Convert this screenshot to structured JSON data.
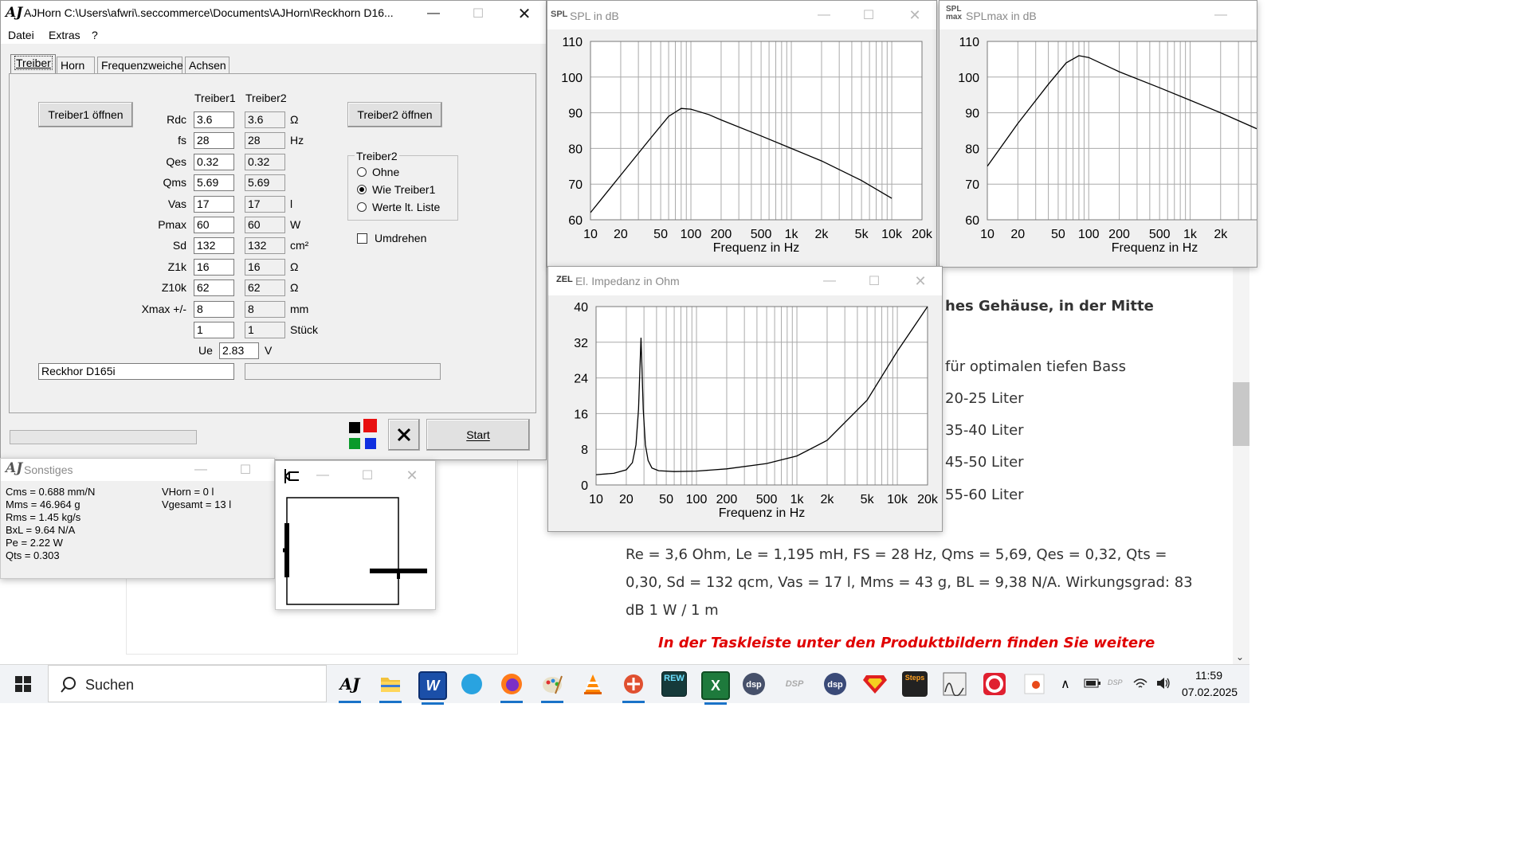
{
  "main_window": {
    "title": "AJHorn  C:\\Users\\afwri\\.seccommerce\\Documents\\AJHorn\\Reckhorn D16...",
    "menu": [
      "Datei",
      "Extras",
      "?"
    ],
    "tabs": [
      "Treiber",
      "Horn",
      "Frequenzweiche",
      "Achsen"
    ],
    "col_header_1": "Treiber1",
    "col_header_2": "Treiber2",
    "open_driver1_button": "Treiber1 öffnen",
    "open_driver2_button": "Treiber2 öffnen",
    "params": [
      {
        "label": "Rdc",
        "v1": "3.6",
        "v2": "3.6",
        "unit": "Ω"
      },
      {
        "label": "fs",
        "v1": "28",
        "v2": "28",
        "unit": "Hz"
      },
      {
        "label": "Qes",
        "v1": "0.32",
        "v2": "0.32",
        "unit": ""
      },
      {
        "label": "Qms",
        "v1": "5.69",
        "v2": "5.69",
        "unit": ""
      },
      {
        "label": "Vas",
        "v1": "17",
        "v2": "17",
        "unit": "l"
      },
      {
        "label": "Pmax",
        "v1": "60",
        "v2": "60",
        "unit": "W"
      },
      {
        "label": "Sd",
        "v1": "132",
        "v2": "132",
        "unit": "cm²"
      },
      {
        "label": "Z1k",
        "v1": "16",
        "v2": "16",
        "unit": "Ω"
      },
      {
        "label": "Z10k",
        "v1": "62",
        "v2": "62",
        "unit": "Ω"
      },
      {
        "label": "Xmax +/-",
        "v1": "8",
        "v2": "8",
        "unit": "mm"
      },
      {
        "label": "",
        "v1": "1",
        "v2": "1",
        "unit": "Stück"
      }
    ],
    "ue_label": "Ue",
    "ue_value": "2.83",
    "ue_unit": "V",
    "driver2_group_label": "Treiber2",
    "driver2_options": [
      "Ohne",
      "Wie Treiber1",
      "Werte lt. Liste"
    ],
    "driver2_selected": "Wie Treiber1",
    "invert_label": "Umdrehen",
    "driver1_name": "Reckhor D165i",
    "driver2_name": "",
    "start_button": "Start",
    "colors": {
      "black": "#000000",
      "red": "#e81010",
      "green": "#0a9a2a",
      "blue": "#1030e0"
    }
  },
  "sonstiges_window": {
    "title": "Sonstiges",
    "left": [
      "Cms = 0.688 mm/N",
      "Mms = 46.964 g",
      "Rms = 1.45 kg/s",
      "BxL = 9.64 N/A",
      "Pe = 2.22 W",
      "Qts = 0.303"
    ],
    "right": [
      "VHorn = 0 l",
      "Vgesamt = 13 l"
    ]
  },
  "spl_window": {
    "icon_text": "SPL",
    "title": "SPL in dB",
    "chart_data": {
      "type": "line",
      "title": "SPL in dB",
      "xlabel": "Frequenz in Hz",
      "ylabel": "",
      "xscale": "log",
      "xlim": [
        10,
        20000
      ],
      "ylim": [
        60,
        110
      ],
      "xticks": [
        "10",
        "20",
        "50",
        "100",
        "200",
        "500",
        "1k",
        "2k",
        "5k",
        "10k",
        "20k"
      ],
      "yticks": [
        "60",
        "70",
        "80",
        "90",
        "100",
        "110"
      ],
      "x": [
        10,
        20,
        40,
        60,
        80,
        100,
        150,
        200,
        500,
        1000,
        2000,
        5000,
        10000
      ],
      "y": [
        62,
        72.5,
        83,
        89,
        91.2,
        91,
        89.5,
        88,
        83.5,
        80,
        76.5,
        71,
        66
      ]
    }
  },
  "splmax_window": {
    "icon_text": "SPL max",
    "title": "SPLmax in dB",
    "chart_data": {
      "type": "line",
      "title": "SPLmax in dB",
      "xlabel": "Frequenz in Hz",
      "xscale": "log",
      "xlim": [
        10,
        5000
      ],
      "ylim": [
        60,
        110
      ],
      "xticks": [
        "10",
        "20",
        "50",
        "100",
        "200",
        "500",
        "1k",
        "2k"
      ],
      "yticks": [
        "60",
        "70",
        "80",
        "90",
        "100",
        "110"
      ],
      "x": [
        10,
        20,
        40,
        60,
        80,
        100,
        200,
        500,
        1000,
        2000,
        5000
      ],
      "y": [
        75,
        87,
        98,
        104,
        106,
        105.5,
        101.5,
        97,
        93.5,
        90,
        85
      ]
    }
  },
  "impedance_window": {
    "icon_text": "ZEL",
    "title": "El. Impedanz in Ohm",
    "chart_data": {
      "type": "line",
      "title": "El. Impedanz in Ohm",
      "xlabel": "Frequenz in Hz",
      "xscale": "log",
      "xlim": [
        10,
        20000
      ],
      "ylim": [
        0,
        40
      ],
      "xticks": [
        "10",
        "20",
        "50",
        "100",
        "200",
        "500",
        "1k",
        "2k",
        "5k",
        "10k",
        "20k"
      ],
      "yticks": [
        "0",
        "8",
        "16",
        "24",
        "32",
        "40"
      ],
      "x": [
        10,
        15,
        20,
        23,
        25,
        26.5,
        27.5,
        28,
        28.5,
        29.5,
        31,
        33,
        36,
        42,
        60,
        100,
        200,
        500,
        1000,
        2000,
        5000,
        10000,
        20000
      ],
      "y": [
        2.3,
        2.6,
        3.4,
        5.0,
        9.0,
        17,
        28,
        33,
        28,
        17,
        9,
        5.5,
        3.8,
        3.2,
        3.0,
        3.1,
        3.6,
        4.8,
        6.5,
        10,
        19,
        30,
        40
      ]
    }
  },
  "doc_text": {
    "line_gehaeuse": "hes Gehäuse, in der Mitte",
    "line_bass": "für optimalen tiefen Bass",
    "line_20": "20-25 Liter",
    "line_35": "35-40 Liter",
    "line_45": "45-50 Liter",
    "line_55": "55-60 Liter",
    "params_line1": "Re = 3,6 Ohm, Le = 1,195 mH, FS = 28 Hz, Qms = 5,69, Qes = 0,32, Qts =",
    "params_line2": "0,30, Sd = 132 qcm, Vas = 17 l, Mms = 43 g, BL = 9,38 N/A. Wirkungsgrad: 83",
    "params_line3": "dB 1 W / 1 m",
    "red_note": "In der Taskleiste unter den Produktbildern finden Sie weitere"
  },
  "taskbar": {
    "search_placeholder": "Suchen",
    "time": "11:59",
    "date": "07.02.2025",
    "icons": [
      "ajhorn-icon",
      "explorer-icon",
      "word-icon",
      "app-circle-icon",
      "firefox-icon",
      "paint-icon",
      "vlc-icon",
      "app-red-icon",
      "rew-icon",
      "excel-icon",
      "dsp-icon",
      "dsp-gray-icon",
      "dsp2-icon",
      "superman-icon",
      "steps-icon",
      "graph-icon",
      "ccleaner-icon",
      "office-icon"
    ],
    "icon_labels": {
      "rew": "REW",
      "steps": "Steps",
      "dsp": "dsp",
      "dsp_gray": "DSP"
    }
  }
}
